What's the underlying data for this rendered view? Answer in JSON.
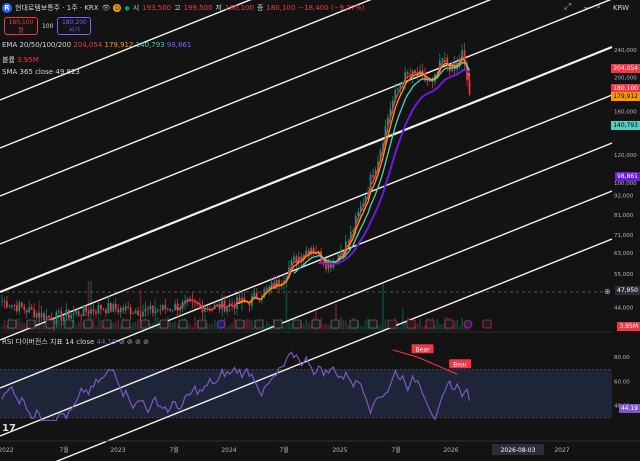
{
  "header": {
    "logo": "R",
    "symbol": "현대로템보통주 · 1주 · KRX",
    "d_badge": "D",
    "open_label": "시",
    "open": "193,500",
    "high_label": "고",
    "high": "199,500",
    "low_label": "저",
    "low": "180,100",
    "close_label": "종",
    "close": "180,100",
    "change": "−18,400 (−9.27%)",
    "currency": "KRW"
  },
  "trade": {
    "sell_price": "180,100",
    "sell_label": "팔",
    "spread": "100",
    "buy_price": "180,200",
    "buy_label": "사기"
  },
  "legends": {
    "ema_label": "EMA 20/50/100/200",
    "ema_values": [
      "204,054",
      "179,912",
      "140,793",
      "98,861"
    ],
    "vol_label": "볼륨",
    "vol_value": "3.95M",
    "sma_label": "SMA 365 close",
    "sma_value": "49,823",
    "rsi_label": "RSI 다이버전스 지표 14 close",
    "rsi_value": "44.19"
  },
  "colors": {
    "up": "#089981",
    "down": "#f23645",
    "ema20": "#f23645",
    "ema50": "#ff9800",
    "ema100": "#4dd0c1",
    "ema200": "#6a1bdc",
    "rsi": "#7e57c2",
    "channel": "#ffffff"
  },
  "right_labels": {
    "ema20": "204,054",
    "close": "180,100",
    "ema50": "179,912",
    "ema100": "140,793",
    "ema200": "98,861",
    "sma": "47,950",
    "volume": "3.95M",
    "rsi": "44.19"
  },
  "chart_data": {
    "type": "candlestick",
    "x_ticks": [
      "2022",
      "7월",
      "2023",
      "7월",
      "2024",
      "7월",
      "2025",
      "7월",
      "2026",
      "2026-08-03",
      "2027"
    ],
    "price_axis": [
      "240,000",
      "200,000",
      "160,000",
      "120,000",
      "100,000",
      "92,000",
      "81,000",
      "71,000",
      "63,000",
      "55,000",
      "44,000"
    ],
    "price_scale": "log",
    "price_range": [
      38000,
      300000
    ],
    "sma365_value": 47950,
    "ema_last": {
      "ema20": 204054,
      "ema50": 179912,
      "ema100": 140793,
      "ema200": 98861
    },
    "ohlc_last": {
      "open": 193500,
      "high": 199500,
      "low": 180100,
      "close": 180100
    },
    "channel_lines": 9,
    "rsi": {
      "axis": [
        "80.00",
        "60.00",
        "40.00"
      ],
      "range": [
        20,
        90
      ],
      "band": [
        30,
        70
      ],
      "last": 44.19,
      "labels": [
        "Bear",
        "Bear"
      ]
    }
  }
}
